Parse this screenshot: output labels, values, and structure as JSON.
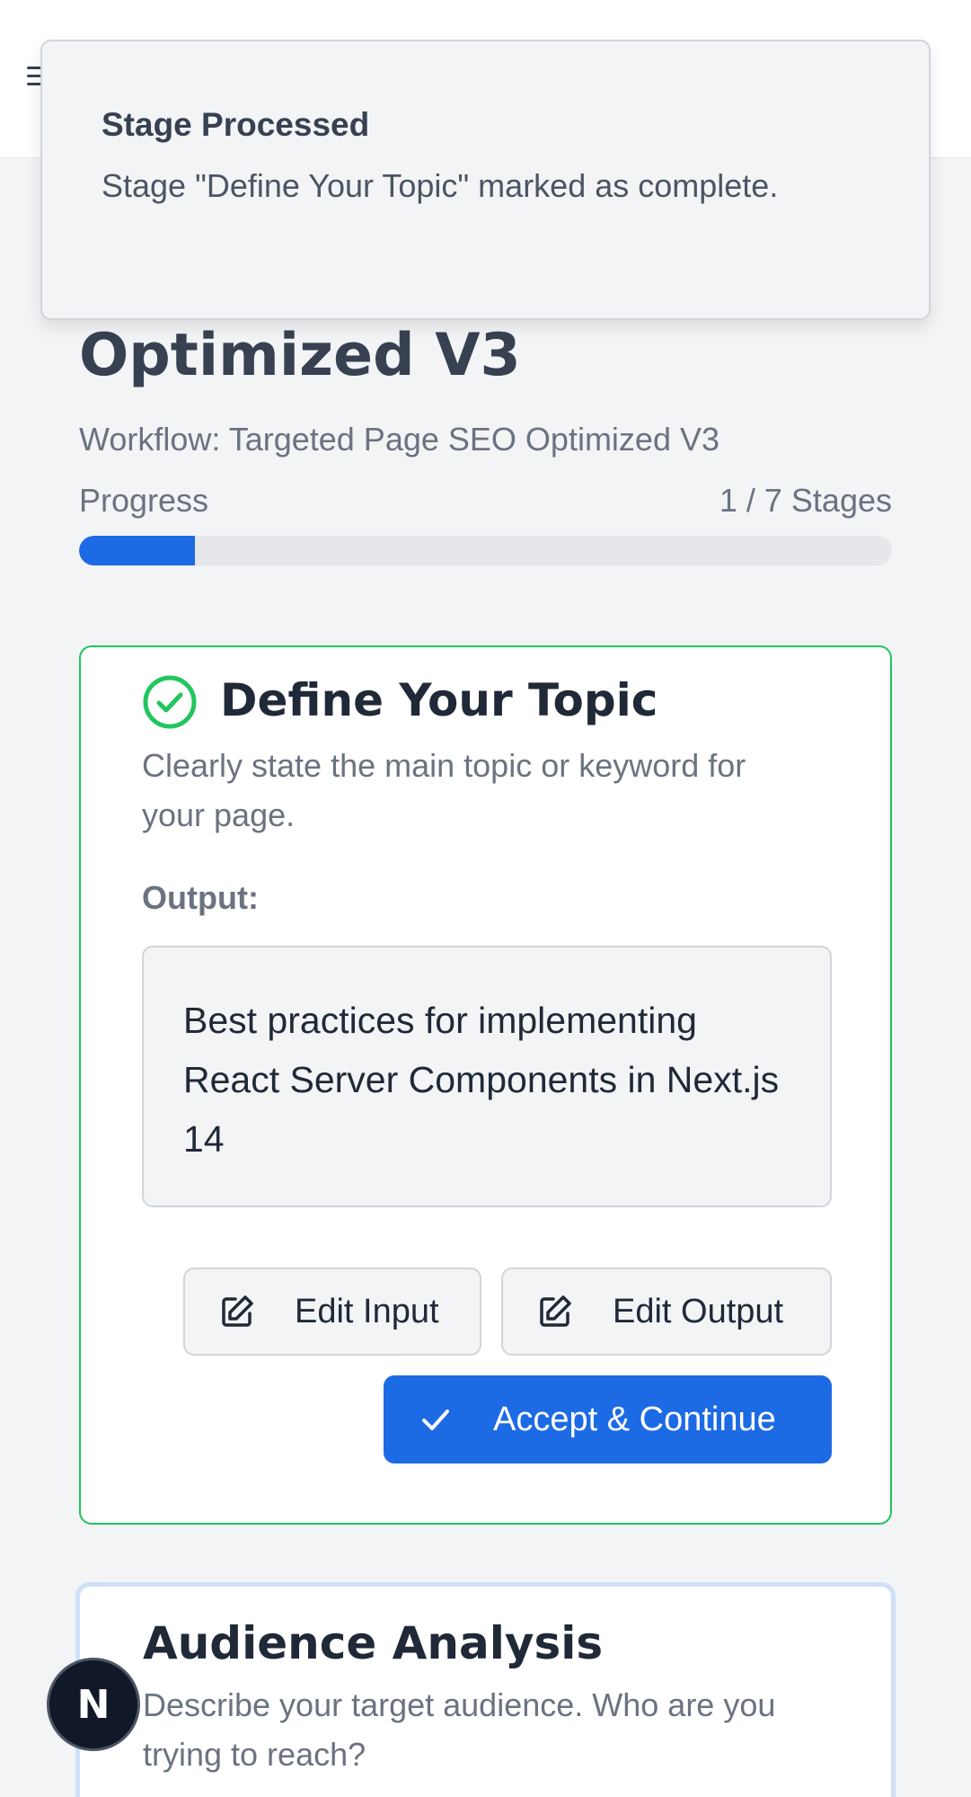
{
  "header": {
    "menu_icon": "hamburger-icon"
  },
  "toast": {
    "title": "Stage Processed",
    "message": "Stage \"Define Your Topic\" marked as complete."
  },
  "page": {
    "title": "Optimized V3",
    "workflow_label": "Workflow: Targeted Page SEO Optimized V3",
    "progress_label": "Progress",
    "progress_count": "1 / 7 Stages",
    "progress_fraction": 0.1429
  },
  "stage": {
    "status_icon": "check-circle-icon",
    "title": "Define Your Topic",
    "description": "Clearly state the main topic or keyword for your page.",
    "output_label": "Output:",
    "output_text": "Best practices for implementing React Server Components in Next.js 14",
    "buttons": {
      "edit_input": "Edit Input",
      "edit_output": "Edit Output",
      "accept": "Accept & Continue"
    }
  },
  "next_stage": {
    "title": "Audience Analysis",
    "description": "Describe your target audience. Who are you trying to reach?"
  },
  "dev_badge": {
    "letter": "N"
  },
  "colors": {
    "accent": "#1d6ae5",
    "success": "#22c55e",
    "text_muted": "#6b7280"
  }
}
